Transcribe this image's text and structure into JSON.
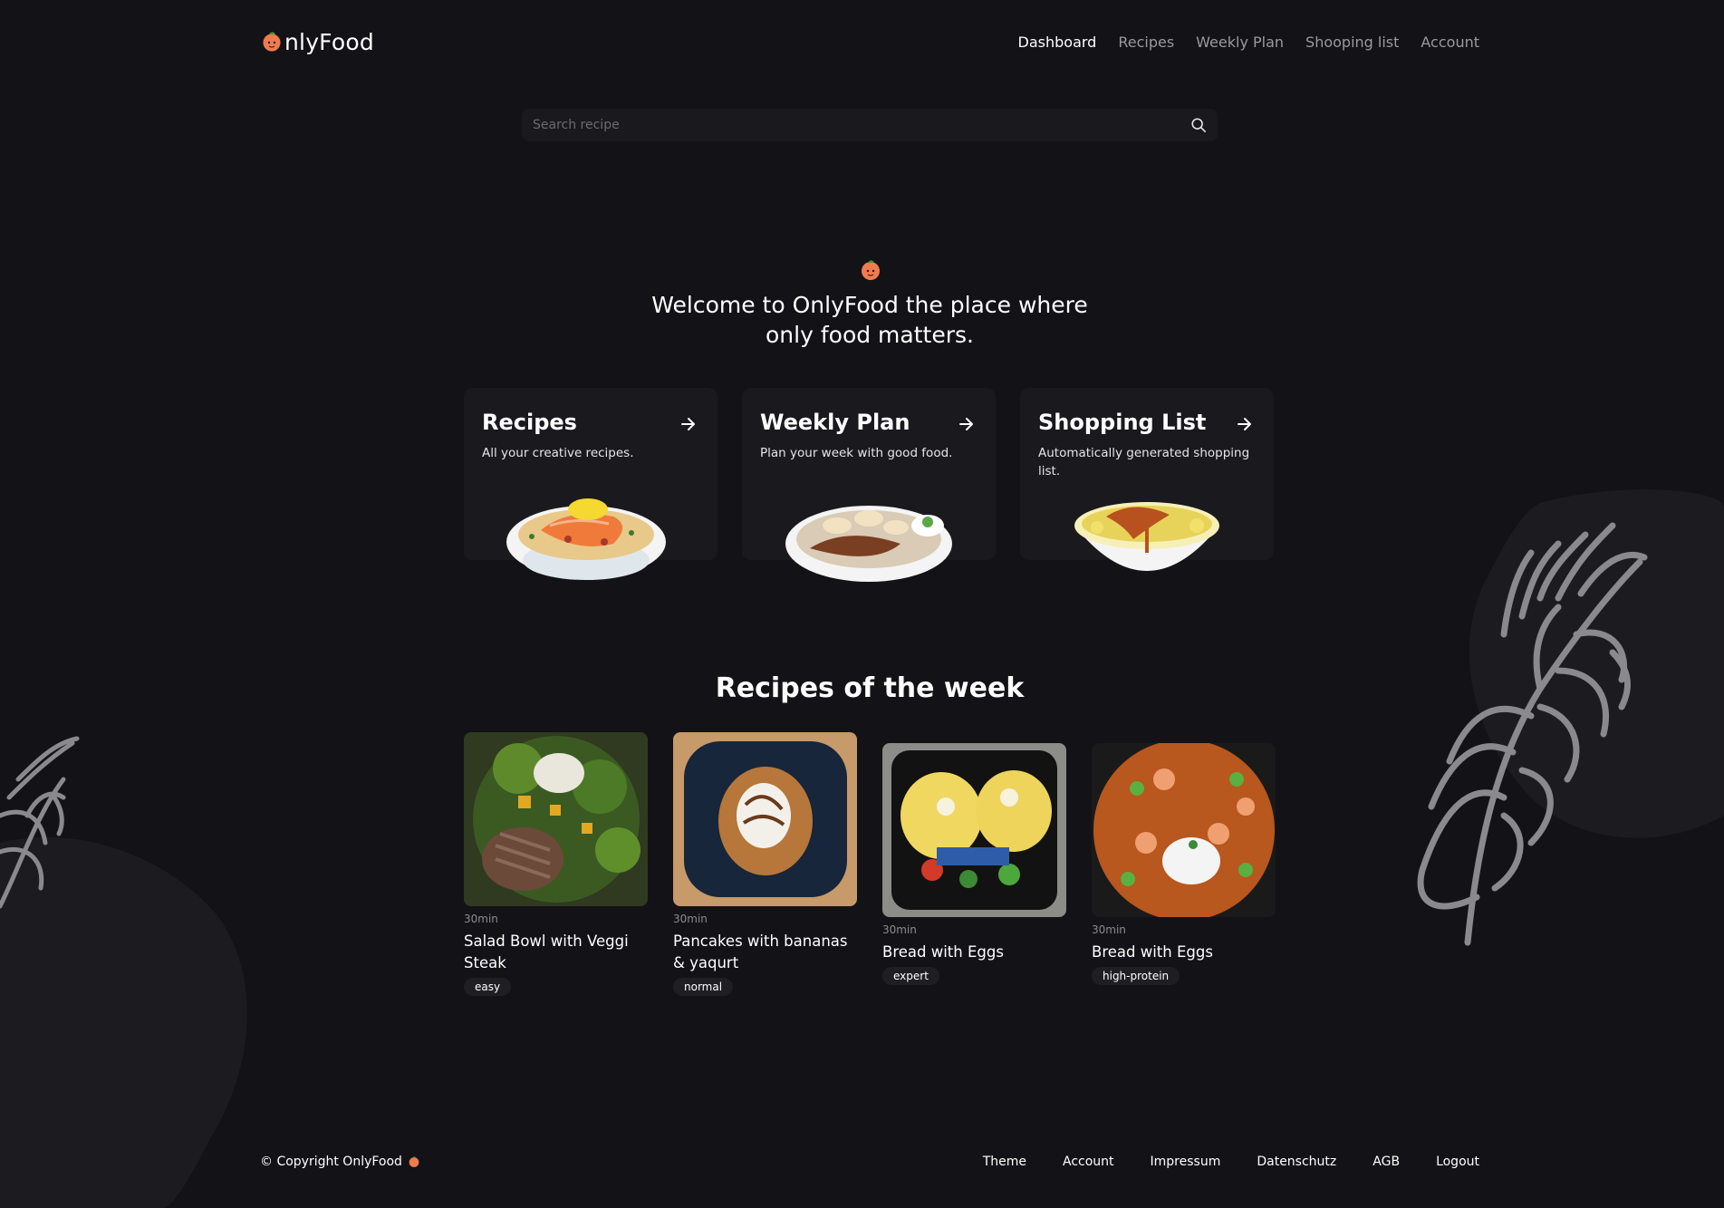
{
  "header": {
    "logo_text": "nlyFood",
    "nav": [
      {
        "label": "Dashboard",
        "active": true
      },
      {
        "label": "Recipes",
        "active": false
      },
      {
        "label": "Weekly Plan",
        "active": false
      },
      {
        "label": "Shooping list",
        "active": false
      },
      {
        "label": "Account",
        "active": false
      }
    ]
  },
  "search": {
    "placeholder": "Search recipe"
  },
  "hero": {
    "line1": "Welcome to OnlyFood the place where",
    "line2": "only food matters."
  },
  "cards": [
    {
      "title": "Recipes",
      "subtitle": "All your creative recipes."
    },
    {
      "title": "Weekly Plan",
      "subtitle": "Plan your week with good food."
    },
    {
      "title": "Shopping List",
      "subtitle": "Automatically generated shopping list."
    }
  ],
  "section_title": "Recipes of the week",
  "recipes": [
    {
      "time": "30min",
      "name": "Salad Bowl with Veggi Steak",
      "tag": "easy"
    },
    {
      "time": "30min",
      "name": "Pancakes with bananas & yaqurt",
      "tag": "normal"
    },
    {
      "time": "30min",
      "name": "Bread with Eggs",
      "tag": "expert"
    },
    {
      "time": "30min",
      "name": "Bread with Eggs",
      "tag": "high-protein"
    }
  ],
  "footer": {
    "copyright": "© Copyright OnlyFood",
    "links": [
      "Theme",
      "Account",
      "Impressum",
      "Datenschutz",
      "AGB",
      "Logout"
    ]
  },
  "colors": {
    "background": "#131216",
    "card": "#1a191e",
    "brand": "#f07b4f"
  },
  "icons": [
    "peach-logo-icon",
    "search-icon",
    "arrow-right-icon",
    "leaf-decoration-icon"
  ]
}
